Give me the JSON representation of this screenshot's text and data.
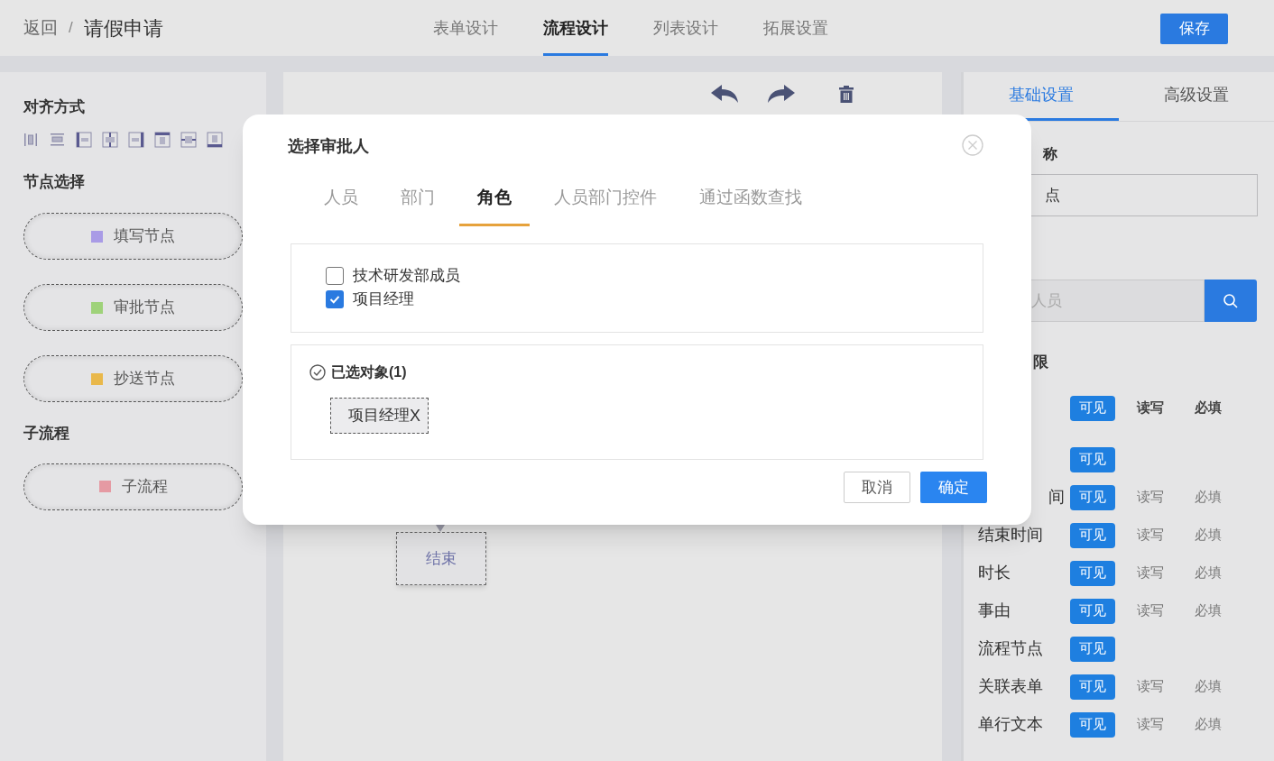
{
  "header": {
    "back": "返回",
    "separator": "/",
    "title": "请假申请",
    "save": "保存",
    "tabs": [
      {
        "label": "表单设计",
        "selected": false
      },
      {
        "label": "流程设计",
        "selected": true
      },
      {
        "label": "列表设计",
        "selected": false
      },
      {
        "label": "拓展设置",
        "selected": false
      }
    ]
  },
  "left_panel": {
    "align_title": "对齐方式",
    "node_title": "节点选择",
    "nodes": [
      {
        "label": "填写节点",
        "color": "#a99be6"
      },
      {
        "label": "审批节点",
        "color": "#9fd27a"
      },
      {
        "label": "抄送节点",
        "color": "#e9b84b"
      }
    ],
    "subflow_title": "子流程",
    "subflows": [
      {
        "label": "子流程",
        "color": "#e59aa3"
      }
    ]
  },
  "canvas": {
    "end_node": "结束"
  },
  "settings": {
    "tabs": [
      {
        "label": "基础设置",
        "selected": true
      },
      {
        "label": "高级设置",
        "selected": false
      }
    ],
    "name_label": "称",
    "name_value": "点",
    "search_placeholder": "人员",
    "permission_title": "限",
    "rows": [
      {
        "kind": "header",
        "options": [
          {
            "label": "可见",
            "selected": true
          },
          {
            "label": "读写",
            "selected": false
          },
          {
            "label": "必填",
            "selected": false
          }
        ]
      },
      {
        "kind": "field",
        "options": [
          {
            "label": "可见",
            "selected": true
          }
        ]
      },
      {
        "kind": "field",
        "label": "间",
        "options": [
          {
            "label": "可见",
            "selected": true
          },
          {
            "label": "读写",
            "selected": false
          },
          {
            "label": "必填",
            "selected": false
          }
        ]
      },
      {
        "kind": "field",
        "label": "结束时间",
        "options": [
          {
            "label": "可见",
            "selected": true
          },
          {
            "label": "读写",
            "selected": false
          },
          {
            "label": "必填",
            "selected": false
          }
        ]
      },
      {
        "kind": "field",
        "label": "时长",
        "options": [
          {
            "label": "可见",
            "selected": true
          },
          {
            "label": "读写",
            "selected": false
          },
          {
            "label": "必填",
            "selected": false
          }
        ]
      },
      {
        "kind": "field",
        "label": "事由",
        "options": [
          {
            "label": "可见",
            "selected": true
          },
          {
            "label": "读写",
            "selected": false
          },
          {
            "label": "必填",
            "selected": false
          }
        ]
      },
      {
        "kind": "field",
        "label": "流程节点",
        "options": [
          {
            "label": "可见",
            "selected": true
          }
        ]
      },
      {
        "kind": "field",
        "label": "关联表单",
        "options": [
          {
            "label": "可见",
            "selected": true
          },
          {
            "label": "读写",
            "selected": false
          },
          {
            "label": "必填",
            "selected": false
          }
        ]
      },
      {
        "kind": "field",
        "label": "单行文本",
        "options": [
          {
            "label": "可见",
            "selected": true
          },
          {
            "label": "读写",
            "selected": false
          },
          {
            "label": "必填",
            "selected": false
          }
        ]
      }
    ]
  },
  "dialog": {
    "title": "选择审批人",
    "tabs": [
      {
        "label": "人员",
        "selected": false
      },
      {
        "label": "部门",
        "selected": false
      },
      {
        "label": "角色",
        "selected": true
      },
      {
        "label": "人员部门控件",
        "selected": false
      },
      {
        "label": "通过函数查找",
        "selected": false
      }
    ],
    "roles": [
      {
        "label": "技术研发部成员",
        "checked": false
      },
      {
        "label": "项目经理",
        "checked": true
      }
    ],
    "selected_title": "已选对象(1)",
    "selected_tags": [
      {
        "label": "项目经理",
        "remove": "X"
      }
    ],
    "buttons": [
      {
        "kind": "cancel",
        "label": "取消"
      },
      {
        "kind": "primary",
        "label": "确定"
      }
    ]
  }
}
